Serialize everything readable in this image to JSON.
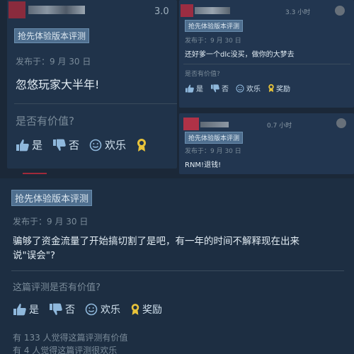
{
  "review_left": {
    "score": "3.0",
    "badge": "抢先体验版本评测",
    "posted": "发布于：9 月 30 日",
    "text": "忽悠玩家大半年!",
    "helpful_prompt": "是否有价值?",
    "yes": "是",
    "no": "否",
    "funny": "欢乐"
  },
  "review_right_top": {
    "hours": "3.3 小时",
    "badge": "抢先体验版本评测",
    "posted": "发布于：9 月 30 日",
    "text": "还好爹一个dlc没买，做你的大梦去",
    "helpful_prompt": "是否有价值?",
    "yes": "是",
    "no": "否",
    "funny": "欢乐",
    "award": "奖励"
  },
  "review_right_bottom": {
    "hours": "0.7 小时",
    "badge": "抢先体验版本评测",
    "posted": "发布于：9 月 30 日",
    "text": "RNM!退钱!"
  },
  "review_main": {
    "badge": "抢先体验版本评测",
    "posted": "发布于：9 月 30 日",
    "text_line1": "骗够了资金流量了开始搞切割了是吧，有一年的时间不解释现在出来",
    "text_line2": "说\"误会\"?",
    "helpful_prompt": "这篇评测是否有价值?",
    "yes": "是",
    "no": "否",
    "funny": "欢乐",
    "award": "奖励",
    "stat_helpful": "有 133 人觉得这篇评测有价值",
    "stat_funny": "有 4 人觉得这篇评测很欢乐"
  },
  "colors": {
    "background": "#1b2838",
    "card": "#20334a",
    "badge": "#4f6f8f",
    "award_gold": "#e8c33a",
    "vote_blue": "#8fb8dc"
  },
  "icons": [
    "thumbs-up-icon",
    "thumbs-down-icon",
    "smiley-icon",
    "award-icon",
    "steam-icon"
  ]
}
